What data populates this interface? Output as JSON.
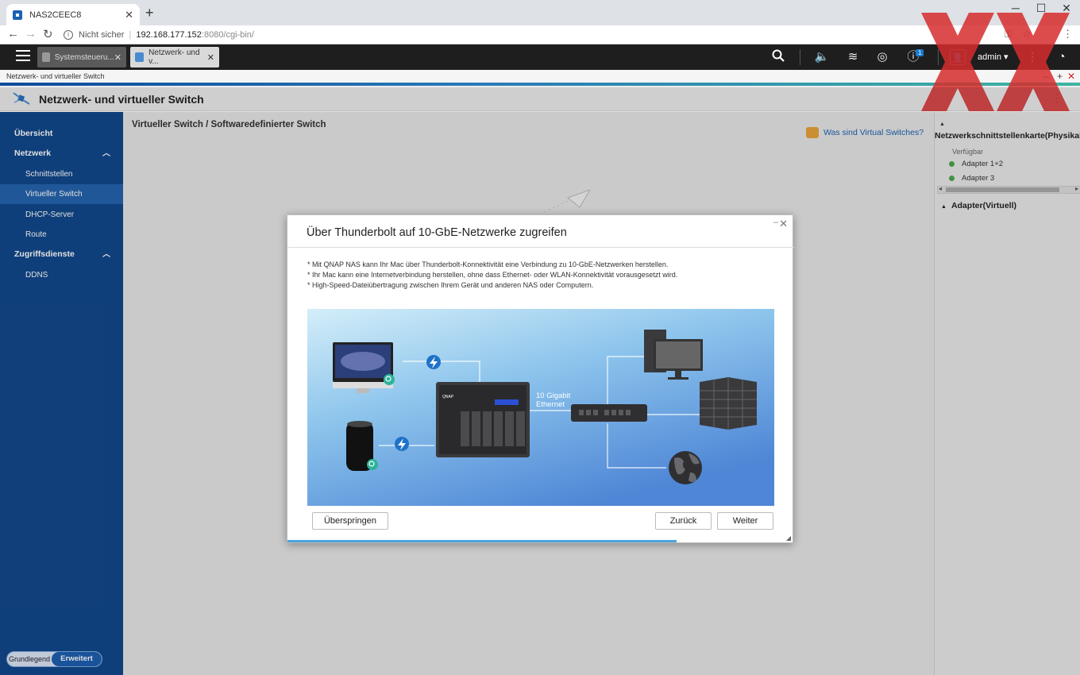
{
  "browser": {
    "tab_title": "NAS2CEEC8",
    "security_label": "Nicht sicher",
    "url_host": "192.168.177.152",
    "url_path": ":8080/cgi-bin/"
  },
  "qts": {
    "tabs": [
      {
        "label": "Systemsteueru..."
      },
      {
        "label": "Netzwerk- und v..."
      }
    ],
    "notification_count": "1",
    "user": "admin ▾"
  },
  "window": {
    "titlebar_text": "Netzwerk- und virtueller Switch",
    "app_title": "Netzwerk- und virtueller Switch"
  },
  "sidebar": {
    "items": [
      {
        "label": "Übersicht"
      },
      {
        "label": "Netzwerk"
      },
      {
        "label": "Schnittstellen"
      },
      {
        "label": "Virtueller Switch"
      },
      {
        "label": "DHCP-Server"
      },
      {
        "label": "Route"
      },
      {
        "label": "Zugriffsdienste"
      },
      {
        "label": "DDNS"
      }
    ],
    "mode_basic": "Grundlegend",
    "mode_advanced": "Erweitert"
  },
  "main": {
    "breadcrumb": "Virtueller Switch / Softwaredefinierter Switch",
    "help_link": "Was sind Virtual Switches?"
  },
  "right_panel": {
    "nic_title": "Netzwerkschnittstellenkarte(Physikalisch)",
    "available_label": "Verfügbar",
    "adapters": [
      {
        "label": "Adapter 1+2"
      },
      {
        "label": "Adapter 3"
      }
    ],
    "virtual_title": "Adapter(Virtuell)"
  },
  "modal": {
    "title": "Über Thunderbolt auf 10-GbE-Netzwerke zugreifen",
    "bullets": [
      "* Mit QNAP NAS kann Ihr Mac über Thunderbolt-Konnektivität eine Verbindung zu 10-GbE-Netzwerken herstellen.",
      "* Ihr Mac kann eine Internetverbindung herstellen, ohne dass Ethernet- oder WLAN-Konnektivität vorausgesetzt wird.",
      "* High-Speed-Dateiübertragung zwischen Ihrem Gerät und anderen NAS oder Computern."
    ],
    "illustration_label": "10 Gigabit\nEthernet",
    "illustration_label_1": "10 Gigabit",
    "illustration_label_2": "Ethernet",
    "illustration_brand": "QNAP",
    "skip_label": "Überspringen",
    "back_label": "Zurück",
    "next_label": "Weiter"
  },
  "colors": {
    "sidebar_bg": "#12488b",
    "sidebar_active": "#2563ad",
    "accent": "#1a62b5",
    "status_green": "#4aa84a",
    "watermark_red": "#d62d2d"
  }
}
